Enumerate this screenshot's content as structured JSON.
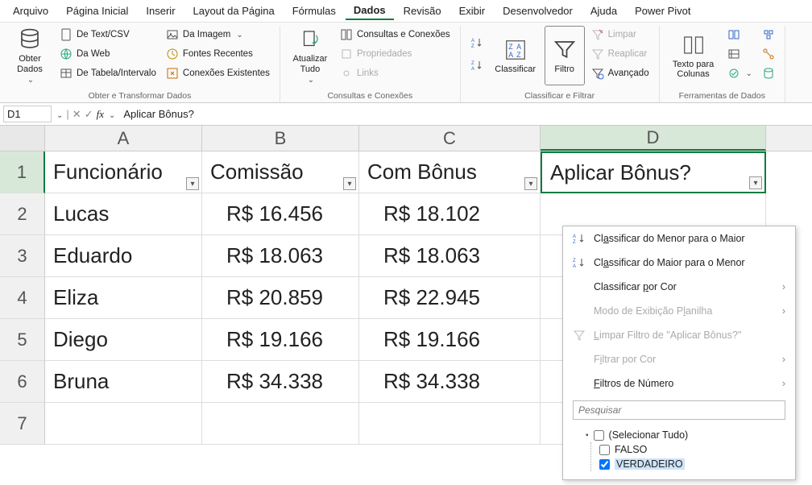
{
  "menubar": [
    "Arquivo",
    "Página Inicial",
    "Inserir",
    "Layout da Página",
    "Fórmulas",
    "Dados",
    "Revisão",
    "Exibir",
    "Desenvolvedor",
    "Ajuda",
    "Power Pivot"
  ],
  "active_menu": "Dados",
  "ribbon": {
    "group1": {
      "big": "Obter\nDados",
      "items": [
        "De Text/CSV",
        "Da Web",
        "De Tabela/Intervalo",
        "Da Imagem",
        "Fontes Recentes",
        "Conexões Existentes"
      ],
      "label": "Obter e Transformar Dados"
    },
    "group2": {
      "big": "Atualizar\nTudo",
      "items": [
        "Consultas e Conexões",
        "Propriedades",
        "Links"
      ],
      "label": "Consultas e Conexões"
    },
    "group3": {
      "big": [
        "Classificar",
        "Filtro"
      ],
      "items": [
        "Limpar",
        "Reaplicar",
        "Avançado"
      ],
      "label": "Classificar e Filtrar"
    },
    "group4": {
      "big": "Texto para\nColunas",
      "label": "Ferramentas de Dados"
    }
  },
  "namebox": "D1",
  "formula": "Aplicar Bônus?",
  "columns": [
    "A",
    "B",
    "C",
    "D"
  ],
  "headers": [
    "Funcionário",
    "Comissão",
    "Com Bônus",
    "Aplicar Bônus?"
  ],
  "rows": [
    {
      "n": "2",
      "a": "Lucas",
      "b": "R$ 16.456",
      "c": "R$ 18.102"
    },
    {
      "n": "3",
      "a": "Eduardo",
      "b": "R$ 18.063",
      "c": "R$ 18.063"
    },
    {
      "n": "4",
      "a": "Eliza",
      "b": "R$ 20.859",
      "c": "R$ 22.945"
    },
    {
      "n": "5",
      "a": "Diego",
      "b": "R$ 19.166",
      "c": "R$ 19.166"
    },
    {
      "n": "6",
      "a": "Bruna",
      "b": "R$ 34.338",
      "c": "R$ 34.338"
    }
  ],
  "filter_menu": {
    "sort_asc": "Classificar do Menor para o Maior",
    "sort_desc": "Classificar do Maior para o Menor",
    "sort_color": "Classificar por Cor",
    "sheet_view": "Modo de Exibição Planilha",
    "clear_filter": "Limpar Filtro de \"Aplicar Bônus?\"",
    "filter_color": "Filtrar por Cor",
    "num_filters": "Filtros de Número",
    "search_placeholder": "Pesquisar",
    "checks": [
      "(Selecionar Tudo)",
      "FALSO",
      "VERDADEIRO"
    ]
  }
}
